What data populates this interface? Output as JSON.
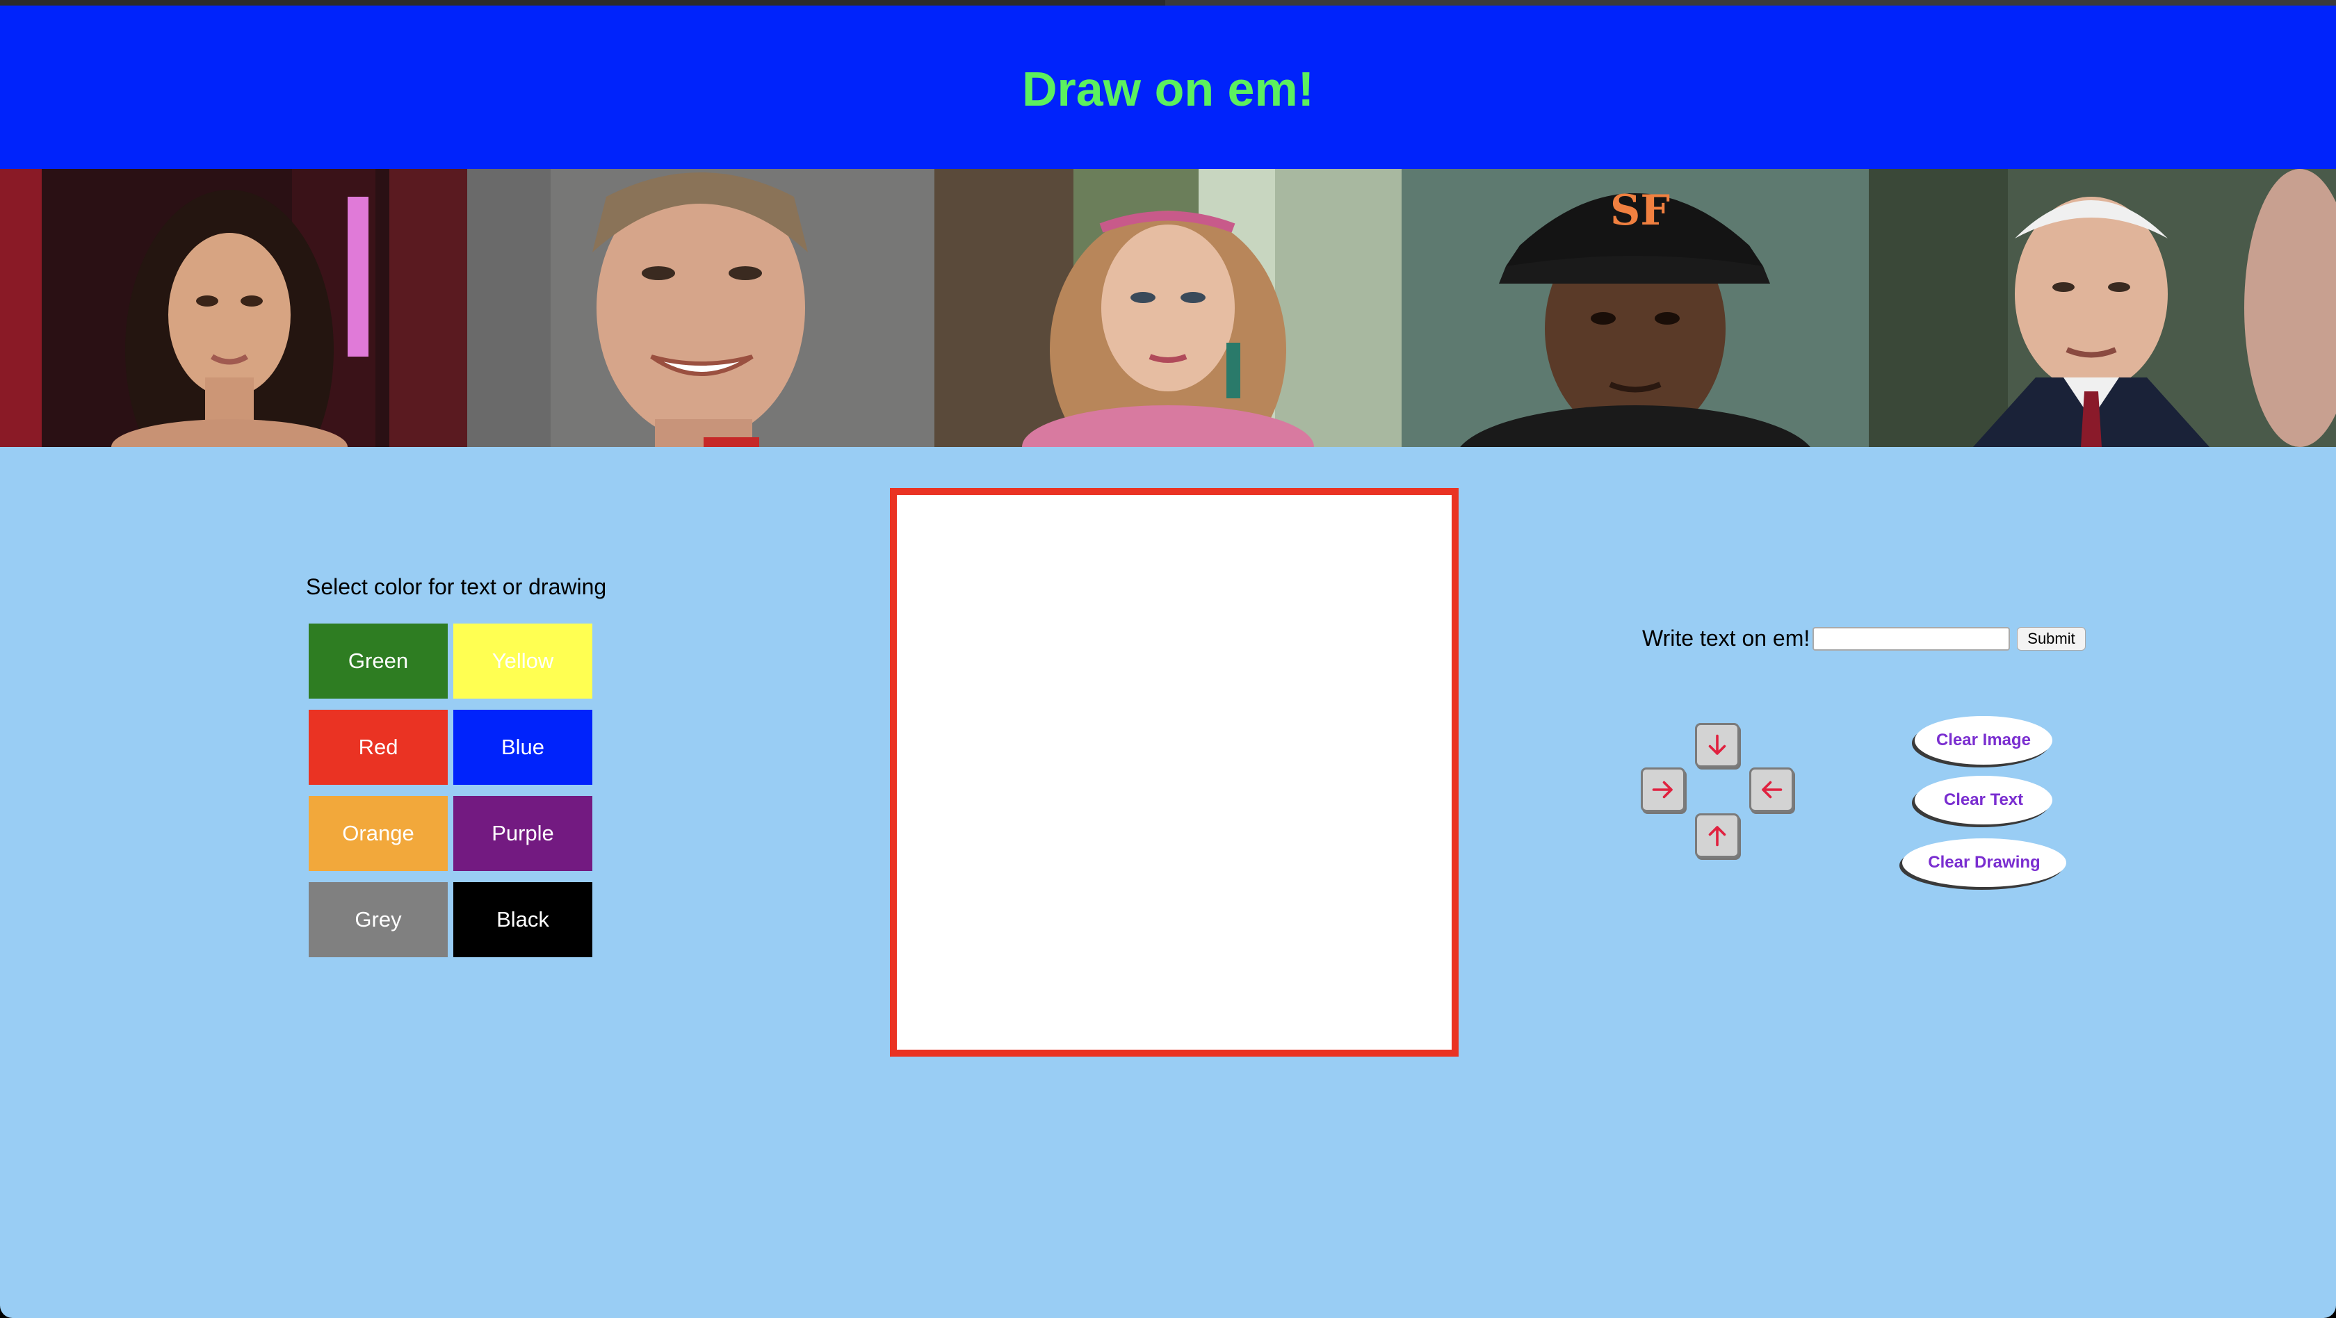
{
  "header": {
    "title": "Draw on em!",
    "title_color": "#5cf05e",
    "background": "#0023fb"
  },
  "portraits": [
    {
      "name": "portrait-1"
    },
    {
      "name": "portrait-2"
    },
    {
      "name": "portrait-3"
    },
    {
      "name": "portrait-4"
    },
    {
      "name": "portrait-5"
    }
  ],
  "colors": {
    "label": "Select color for text or drawing",
    "swatches": [
      {
        "label": "Green",
        "color": "#2e7d22"
      },
      {
        "label": "Yellow",
        "color": "#ffff52"
      },
      {
        "label": "Red",
        "color": "#ea3323"
      },
      {
        "label": "Blue",
        "color": "#0023fb"
      },
      {
        "label": "Orange",
        "color": "#f2a83b"
      },
      {
        "label": "Purple",
        "color": "#731a81"
      },
      {
        "label": "Grey",
        "color": "#808080"
      },
      {
        "label": "Black",
        "color": "#000000"
      }
    ]
  },
  "canvas": {
    "border_color": "#ea3323"
  },
  "text_input": {
    "label": "Write text on em!",
    "value": "",
    "placeholder": "",
    "submit_label": "Submit"
  },
  "arrows": {
    "down_icon": "arrow-down-icon",
    "right_icon": "arrow-right-icon",
    "left_icon": "arrow-left-icon",
    "up_icon": "arrow-up-icon",
    "color": "#e0213f"
  },
  "actions": {
    "clear_image": "Clear Image",
    "clear_text": "Clear Text",
    "clear_drawing": "Clear Drawing"
  },
  "page_background": "#99cdf4"
}
